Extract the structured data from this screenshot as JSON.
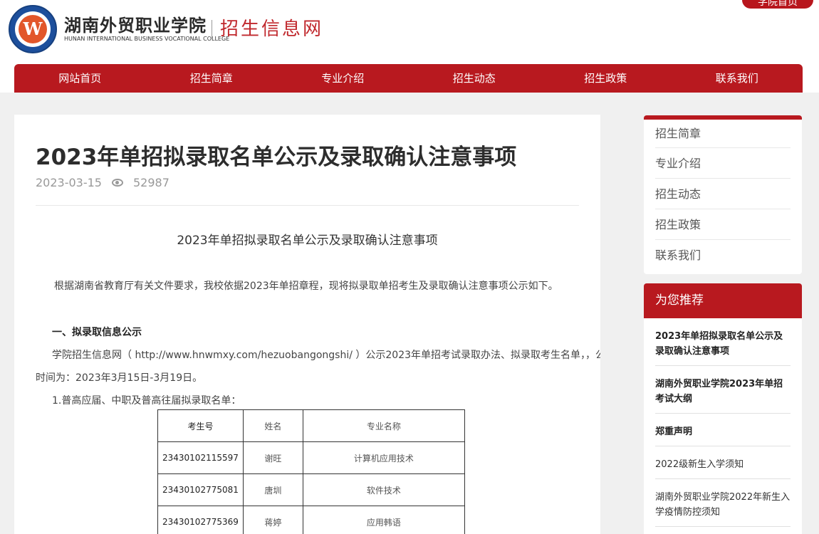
{
  "header": {
    "school_cn": "湖南外贸职业学院",
    "school_en": "HUNAN INTERNATIONAL BUSINESS VOCATIONAL COLLEGE",
    "site_title": "招生信息网",
    "home_button": "学院首页",
    "brand_color": "#b8191f"
  },
  "nav": {
    "items": [
      "网站首页",
      "招生简章",
      "专业介绍",
      "招生动态",
      "招生政策",
      "联系我们"
    ]
  },
  "article": {
    "title": "2023年单招拟录取名单公示及录取确认注意事项",
    "date": "2023-03-15",
    "views": "52987",
    "subtitle": "2023年单招拟录取名单公示及录取确认注意事项",
    "para1": "根据湖南省教育厅有关文件要求，我校依据2023年单招章程，现将拟录取单招考生及录取确认注意事项公示如下。",
    "heading1": "一、拟录取信息公示",
    "para2": "学院招生信息网（ http://www.hnwmxy.com/hezuobangongshi/ ）公示2023年单招考试录取办法、拟录取考生名单，，公示",
    "para3": "时间为：2023年3月15日-3月19日。",
    "list_title": "1.普高应届、中职及普高往届拟录取名单：",
    "table": {
      "headers": [
        "考生号",
        "姓名",
        "专业名称"
      ],
      "rows": [
        [
          "23430102115597",
          "谢旺",
          "计算机应用技术"
        ],
        [
          "23430102775081",
          "唐圳",
          "软件技术"
        ],
        [
          "23430102775369",
          "蒋婷",
          "应用韩语"
        ]
      ]
    }
  },
  "sidebar": {
    "menu": [
      "招生简章",
      "专业介绍",
      "招生动态",
      "招生政策",
      "联系我们"
    ],
    "recommend_title": "为您推荐",
    "recommend": [
      {
        "label": "2023年单招拟录取名单公示及录取确认注意事项",
        "bold": true
      },
      {
        "label": "湖南外贸职业学院2023年单招考试大纲",
        "bold": true
      },
      {
        "label": "郑重声明",
        "bold": true
      },
      {
        "label": "2022级新生入学须知",
        "bold": false
      },
      {
        "label": "湖南外贸职业学院2022年新生入学疫情防控须知",
        "bold": false
      }
    ]
  }
}
